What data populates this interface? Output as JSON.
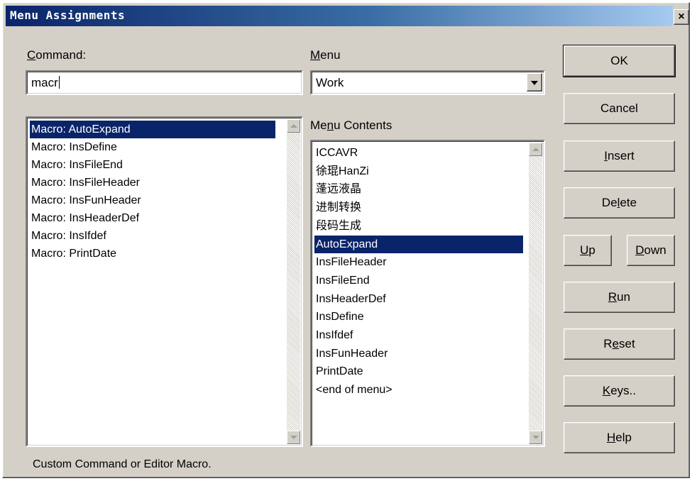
{
  "window": {
    "title": "Menu Assignments",
    "close_label": "×"
  },
  "command": {
    "label_ul": "C",
    "label_rest": "ommand:",
    "input_value": "macr",
    "list": [
      "Macro: AutoExpand",
      "Macro: InsDefine",
      "Macro: InsFileEnd",
      "Macro: InsFileHeader",
      "Macro: InsFunHeader",
      "Macro: InsHeaderDef",
      "Macro: InsIfdef",
      "Macro: PrintDate"
    ],
    "selected_index": 0
  },
  "menu": {
    "label_ul": "M",
    "label_rest": "enu",
    "selected": "Work"
  },
  "menu_contents": {
    "label_pre": "Me",
    "label_ul": "n",
    "label_post": "u Contents",
    "items": [
      "ICCAVR",
      "徐琨HanZi",
      "蓬远液晶",
      "进制转换",
      "段码生成",
      "AutoExpand",
      "InsFileHeader",
      "InsFileEnd",
      "InsHeaderDef",
      "InsDefine",
      "InsIfdef",
      "InsFunHeader",
      "PrintDate",
      "<end of menu>"
    ],
    "selected_index": 5
  },
  "buttons": {
    "ok": "OK",
    "cancel": "Cancel",
    "insert_ul": "I",
    "insert_rest": "nsert",
    "delete_pre": "De",
    "delete_ul": "l",
    "delete_post": "ete",
    "up_ul": "U",
    "up_rest": "p",
    "down_ul": "D",
    "down_rest": "own",
    "run_ul": "R",
    "run_rest": "un",
    "reset_pre": "R",
    "reset_ul": "e",
    "reset_post": "set",
    "keys_ul": "K",
    "keys_rest": "eys..",
    "help_ul": "H",
    "help_rest": "elp"
  },
  "status_text": "Custom Command or Editor Macro."
}
